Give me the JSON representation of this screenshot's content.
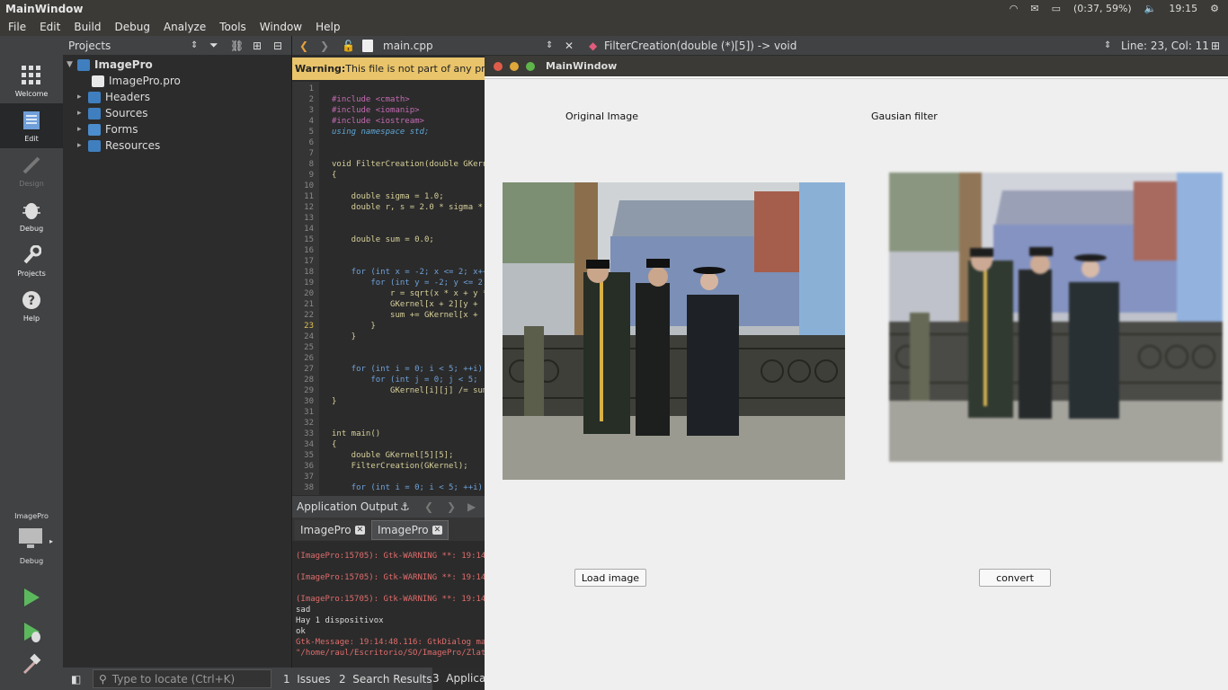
{
  "system_bar": {
    "window_title": "MainWindow",
    "battery": "(0:37, 59%)",
    "clock": "19:15"
  },
  "menu": [
    "File",
    "Edit",
    "Build",
    "Debug",
    "Analyze",
    "Tools",
    "Window",
    "Help"
  ],
  "modes": {
    "welcome": "Welcome",
    "edit": "Edit",
    "design": "Design",
    "debug": "Debug",
    "projects": "Projects",
    "help": "Help",
    "kit_name": "ImagePro",
    "kit_mode": "Debug"
  },
  "projects": {
    "header": "Projects",
    "root": "ImagePro",
    "items": [
      "ImagePro.pro",
      "Headers",
      "Sources",
      "Forms",
      "Resources"
    ]
  },
  "editor": {
    "file": "main.cpp",
    "symbol": "FilterCreation(double (*)[5]) -> void",
    "position": "Line: 23, Col: 11",
    "warning_bold": "Warning:",
    "warning_text": " This file is not part of any project",
    "line_numbers": [
      "1",
      "2",
      "3",
      "4",
      "5",
      "6",
      "7",
      "8",
      "9",
      "10",
      "11",
      "12",
      "13",
      "14",
      "15",
      "16",
      "17",
      "18",
      "19",
      "20",
      "21",
      "22",
      "23",
      "24",
      "25",
      "26",
      "27",
      "28",
      "29",
      "30",
      "31",
      "32",
      "33",
      "34",
      "35",
      "36",
      "37",
      "38"
    ],
    "code": [
      "",
      "#include <cmath>",
      "#include <iomanip>",
      "#include <iostream>",
      "using namespace std;",
      "",
      "",
      "void FilterCreation(double GKern",
      "{",
      "",
      "    double sigma = 1.0;",
      "    double r, s = 2.0 * sigma *",
      "",
      "",
      "    double sum = 0.0;",
      "",
      "",
      "    for (int x = -2; x <= 2; x++",
      "        for (int y = -2; y <= 2;",
      "            r = sqrt(x * x + y *",
      "            GKernel[x + 2][y +",
      "            sum += GKernel[x +",
      "        }",
      "    }",
      "",
      "",
      "    for (int i = 0; i < 5; ++i)",
      "        for (int j = 0; j < 5;",
      "            GKernel[i][j] /= sum",
      "}",
      "",
      "",
      "int main()",
      "{",
      "    double GKernel[5][5];",
      "    FilterCreation(GKernel);",
      "",
      "    for (int i = 0; i < 5; ++i)"
    ]
  },
  "output": {
    "header": "Application Output",
    "tabs": [
      "ImagePro",
      "ImagePro"
    ],
    "lines": [
      "(ImagePro:15705): Gtk-WARNING **: 19:14",
      "",
      "(ImagePro:15705): Gtk-WARNING **: 19:14",
      "",
      "(ImagePro:15705): Gtk-WARNING **: 19:14",
      "sad",
      "Hay 1 dispositivox",
      "ok",
      "Gtk-Message: 19:14:48.116: GtkDialog ma",
      "\"/home/raul/Escritorio/SO/ImagePro/Zlat"
    ]
  },
  "bottom": {
    "locate_placeholder": "Type to locate (Ctrl+K)",
    "tabs": [
      "1  Issues",
      "2  Search Results",
      "3  Applicati"
    ]
  },
  "app": {
    "title": "MainWindow",
    "label_original": "Original Image",
    "label_filter": "Gausian filter",
    "btn_load": "Load image",
    "btn_convert": "convert"
  }
}
